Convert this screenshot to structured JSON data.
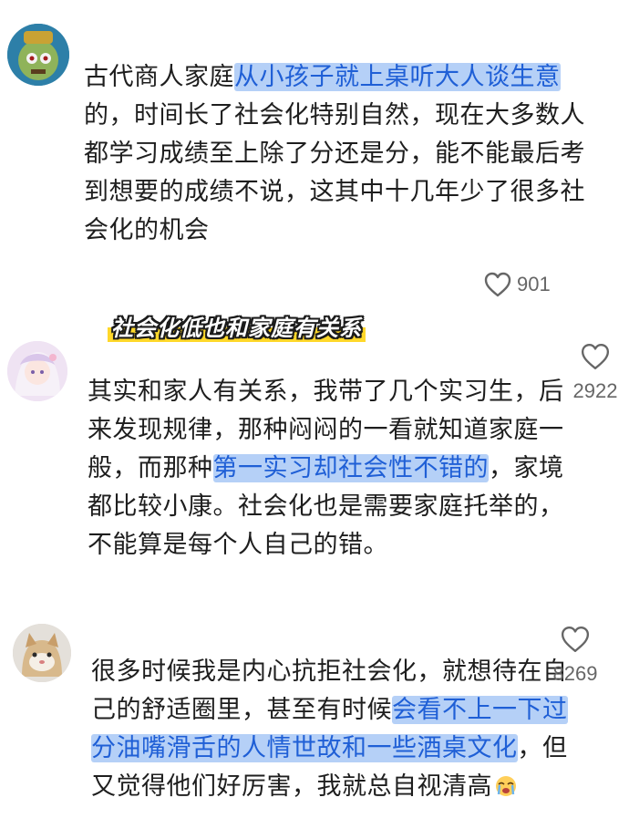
{
  "comments": [
    {
      "lines": [
        {
          "plain": "古代商人家庭",
          "hl": "从小孩子就上桌听大人谈生意",
          "after": ""
        },
        {
          "plain": "的，时间长了社会化特别自然，现在大多数人",
          "hl": "",
          "after": ""
        },
        {
          "plain": "都学习成绩至上除了分还是分，能不能最后考",
          "hl": "",
          "after": ""
        },
        {
          "plain": "到想要的成绩不说，这其中十几年少了很多社",
          "hl": "",
          "after": ""
        },
        {
          "plain": "会化的机会",
          "hl": "",
          "after": ""
        }
      ],
      "likes": "901"
    },
    {
      "lines": [
        {
          "plain": "其实和家人有关系，我带了几个实习生，后",
          "hl": "",
          "after": ""
        },
        {
          "plain": "来发现规律，那种闷闷的一看就知道家庭一",
          "hl": "",
          "after": ""
        },
        {
          "plain": "般，而那种",
          "hl": "第一实习却社会性不错的",
          "after": "，家境"
        },
        {
          "plain": "都比较小康。社会化也是需要家庭托举的，",
          "hl": "",
          "after": ""
        },
        {
          "plain": "不能算是每个人自己的错。",
          "hl": "",
          "after": ""
        }
      ],
      "likes": "2922"
    },
    {
      "lines": [
        {
          "plain": "很多时候我是内心抗拒社会化，就想待在自",
          "hl": "",
          "after": ""
        },
        {
          "plain": "己的舒适圈里，甚至有时候",
          "hl": "会看不上一下过",
          "after": ""
        },
        {
          "plain": "",
          "hl": "分油嘴滑舌的人情世故和一些酒桌文化",
          "after": "，但"
        },
        {
          "plain": "又觉得他们好厉害，我就总自视清高",
          "hl": "",
          "after": ""
        }
      ],
      "likes": "8269"
    }
  ],
  "annotation": "社会化低也和家庭有关系",
  "icons": {
    "heart": "heart-outline-icon",
    "emoji": "crying-face-emoji-icon"
  },
  "colors": {
    "highlight": "#78aaf0",
    "highlight_text": "#1f5fd6",
    "annotation_fill": "#ffd61e"
  }
}
